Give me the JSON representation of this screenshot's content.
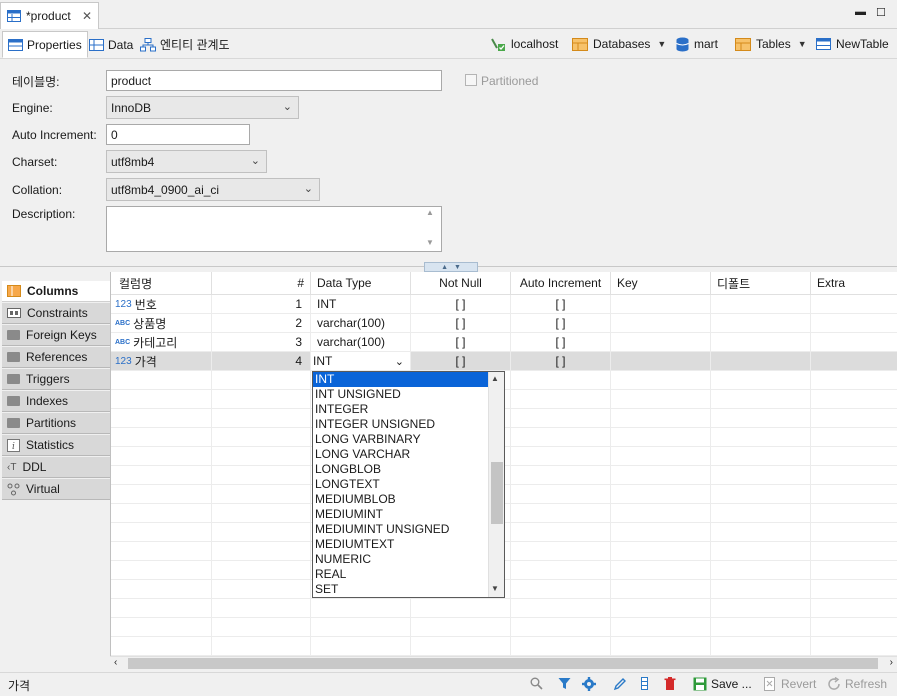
{
  "editor_tab": {
    "title": "*product"
  },
  "subtabs": [
    {
      "label": "Properties"
    },
    {
      "label": "Data"
    },
    {
      "label": "엔티티 관계도"
    }
  ],
  "toolbar": {
    "connection": "localhost",
    "databases": "Databases",
    "schema": "mart",
    "tables": "Tables",
    "table": "NewTable"
  },
  "properties": {
    "table_name_label": "테이블명:",
    "table_name": "product",
    "partitioned_label": "Partitioned",
    "engine_label": "Engine:",
    "engine": "InnoDB",
    "auto_increment_label": "Auto Increment:",
    "auto_increment": "0",
    "charset_label": "Charset:",
    "charset": "utf8mb4",
    "collation_label": "Collation:",
    "collation": "utf8mb4_0900_ai_ci",
    "description_label": "Description:",
    "description": ""
  },
  "sidebar": {
    "items": [
      {
        "label": "Columns"
      },
      {
        "label": "Constraints"
      },
      {
        "label": "Foreign Keys"
      },
      {
        "label": "References"
      },
      {
        "label": "Triggers"
      },
      {
        "label": "Indexes"
      },
      {
        "label": "Partitions"
      },
      {
        "label": "Statistics"
      },
      {
        "label": "DDL"
      },
      {
        "label": "Virtual"
      }
    ]
  },
  "grid": {
    "headers": {
      "name": "컬럼명",
      "num": "#",
      "type": "Data Type",
      "notnull": "Not Null",
      "autoinc": "Auto Increment",
      "key": "Key",
      "default": "디폴트",
      "extra": "Extra"
    },
    "rows": [
      {
        "icon": "123",
        "name": "번호",
        "num": "1",
        "type": "INT",
        "notnull": "[ ]",
        "autoinc": "[ ]"
      },
      {
        "icon": "ABC",
        "name": "상품명",
        "num": "2",
        "type": "varchar(100)",
        "notnull": "[ ]",
        "autoinc": "[ ]"
      },
      {
        "icon": "ABC",
        "name": "카테고리",
        "num": "3",
        "type": "varchar(100)",
        "notnull": "[ ]",
        "autoinc": "[ ]"
      },
      {
        "icon": "123",
        "name": "가격",
        "num": "4",
        "type": "INT",
        "notnull": "[ ]",
        "autoinc": "[ ]"
      }
    ]
  },
  "dropdown": {
    "options": [
      "INT",
      "INT UNSIGNED",
      "INTEGER",
      "INTEGER UNSIGNED",
      "LONG VARBINARY",
      "LONG VARCHAR",
      "LONGBLOB",
      "LONGTEXT",
      "MEDIUMBLOB",
      "MEDIUMINT",
      "MEDIUMINT UNSIGNED",
      "MEDIUMTEXT",
      "NUMERIC",
      "REAL",
      "SET"
    ],
    "selected": "INT"
  },
  "status": {
    "text": "가격",
    "save": "Save ...",
    "revert": "Revert",
    "refresh": "Refresh"
  }
}
